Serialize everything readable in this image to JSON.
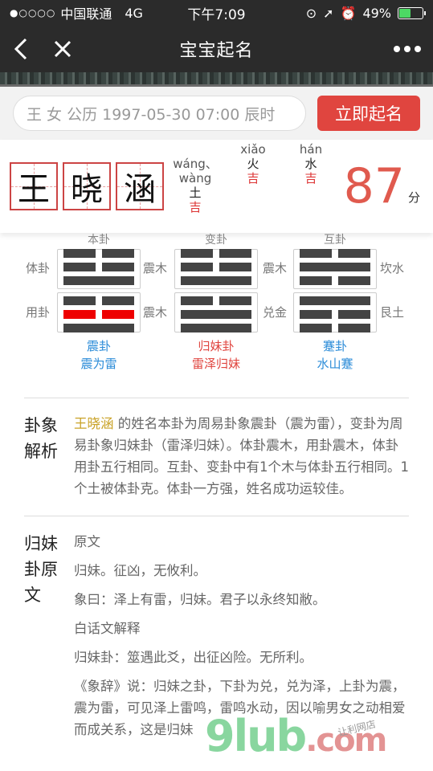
{
  "status": {
    "signal": "●○○○○",
    "carrier": "中国联通",
    "network": "4G",
    "time": "下午7:09",
    "battery": "49%"
  },
  "nav": {
    "title": "宝宝起名"
  },
  "search": {
    "value": "王 女 公历 1997-05-30 07:00 辰时",
    "button": "立即起名"
  },
  "name": {
    "chars": [
      "王",
      "晓",
      "涵"
    ],
    "pinyin": [
      {
        "p": "wáng、\nwàng",
        "w": "土",
        "l": "吉"
      },
      {
        "p": "xiǎo",
        "w": "火",
        "l": "吉"
      },
      {
        "p": "hán",
        "w": "水",
        "l": "吉"
      }
    ],
    "score": "87",
    "score_unit": "分"
  },
  "gua": {
    "cols": [
      {
        "hd": "本卦",
        "n1": "震卦",
        "n2": "震为雷",
        "lside_top": "体卦",
        "lside_bot": "用卦",
        "rside_top": "震木",
        "rside_bot": "震木"
      },
      {
        "hd": "变卦",
        "n1": "归妹卦",
        "n2": "雷泽归妹",
        "rside_top": "震木",
        "rside_bot": "兑金"
      },
      {
        "hd": "互卦",
        "n1": "蹇卦",
        "n2": "水山蹇",
        "rside_top": "坎水",
        "rside_bot": "艮土"
      }
    ]
  },
  "analysis": {
    "label": "卦象解析",
    "name": "王晓涵",
    "text": " 的姓名本卦为周易卦象震卦（震为雷），变卦为周易卦象归妹卦（雷泽归妹）。体卦震木，用卦震木，体卦用卦五行相同。互卦、变卦中有1个木与体卦五行相同。1个土被体卦克。体卦一方强，姓名成功运较佳。"
  },
  "original": {
    "label": "归妹卦原文",
    "lines": [
      "原文",
      "归妹。征凶，无攸利。",
      "象曰：泽上有雷，归妹。君子以永终知敝。",
      "白话文解释",
      "归妹卦：筮遇此爻，出征凶险。无所利。",
      "《象辞》说：归妹之卦，下卦为兑，兑为泽，上卦为震，震为雷，可见泽上雷鸣，雷鸣水动，因以喻男女之动相爱而成关系，这是归妹"
    ]
  },
  "watermark": {
    "a": "9lub",
    "b": ".com",
    "c": "让利网店"
  },
  "colors": {
    "accent": "#e0453f",
    "score": "#e05a4e",
    "highlight": "#c9a227",
    "blue": "#2a8bd8"
  }
}
